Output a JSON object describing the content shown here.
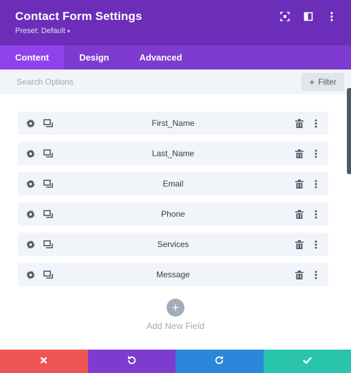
{
  "header": {
    "title": "Contact Form Settings",
    "preset": "Preset: Default",
    "preset_caret": "▾",
    "icons": [
      "expand-icon",
      "split-view-icon",
      "more-options-icon"
    ]
  },
  "tabs": [
    {
      "label": "Content",
      "active": true
    },
    {
      "label": "Design",
      "active": false
    },
    {
      "label": "Advanced",
      "active": false
    }
  ],
  "search": {
    "placeholder": "Search Options",
    "filter_label": "Filter",
    "filter_icon": "plus-icon"
  },
  "fields": [
    {
      "label": "First_Name"
    },
    {
      "label": "Last_Name"
    },
    {
      "label": "Email"
    },
    {
      "label": "Phone"
    },
    {
      "label": "Services"
    },
    {
      "label": "Message"
    }
  ],
  "field_icons": {
    "left": [
      "gear-icon",
      "duplicate-icon"
    ],
    "right": [
      "trash-icon",
      "more-vertical-icon"
    ]
  },
  "add_field": {
    "label": "Add New Field",
    "icon": "plus-icon"
  },
  "footer": [
    {
      "name": "cancel",
      "icon": "close-icon",
      "color": "#ef5555"
    },
    {
      "name": "undo",
      "icon": "undo-icon",
      "color": "#7e3bd0"
    },
    {
      "name": "redo",
      "icon": "redo-icon",
      "color": "#2b87da"
    },
    {
      "name": "save",
      "icon": "checkmark-icon",
      "color": "#29c4a9"
    }
  ],
  "colors": {
    "header": "#6c2eb9",
    "tabs": "#7e3bd0",
    "active_tab": "#8f42ec",
    "row_bg": "#f1f5f9"
  }
}
